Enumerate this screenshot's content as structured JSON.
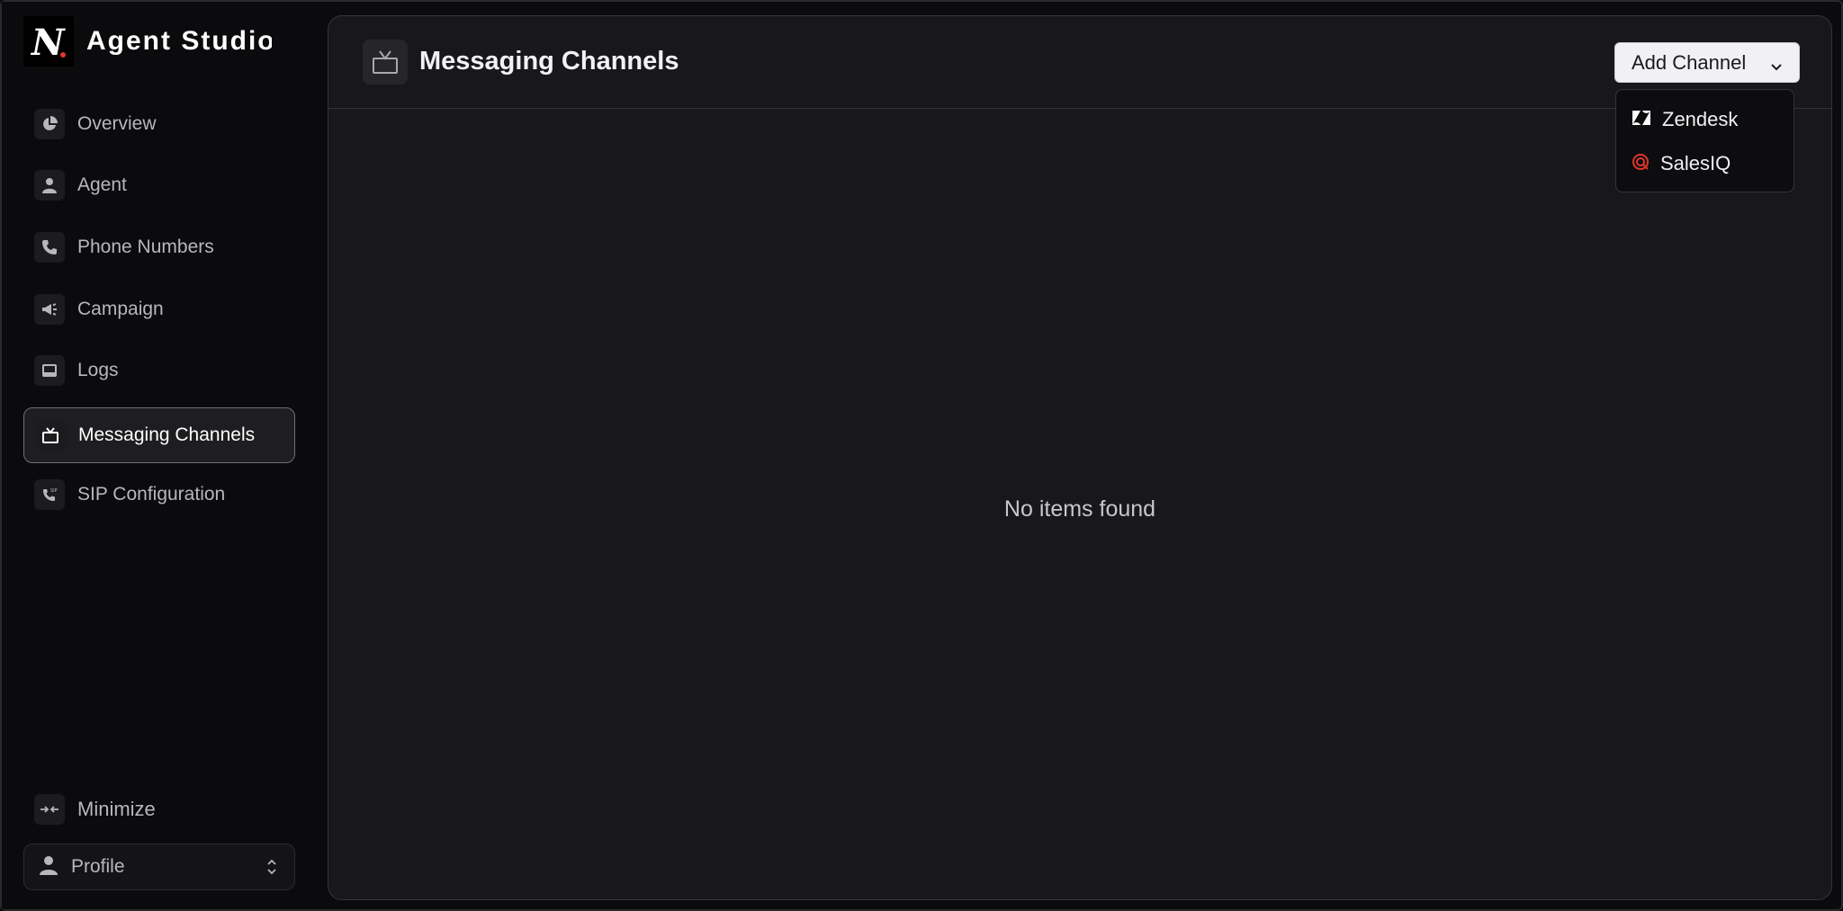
{
  "app": {
    "title": "Agent Studio",
    "logo_text": "N"
  },
  "sidebar": {
    "items": [
      {
        "label": "Overview",
        "icon": "pie-chart-icon",
        "active": false
      },
      {
        "label": "Agent",
        "icon": "person-icon",
        "active": false
      },
      {
        "label": "Phone Numbers",
        "icon": "phone-icon",
        "active": false
      },
      {
        "label": "Campaign",
        "icon": "megaphone-icon",
        "active": false
      },
      {
        "label": "Logs",
        "icon": "terminal-icon",
        "active": false
      },
      {
        "label": "Messaging Channels",
        "icon": "tv-icon",
        "active": true
      },
      {
        "label": "SIP Configuration",
        "icon": "sip-phone-icon",
        "active": false
      }
    ],
    "minimize_label": "Minimize",
    "profile_label": "Profile"
  },
  "main": {
    "title": "Messaging Channels",
    "add_button_label": "Add Channel",
    "empty_message": "No items found"
  },
  "dropdown": {
    "items": [
      {
        "label": "Zendesk",
        "icon": "zendesk-icon"
      },
      {
        "label": "SalesIQ",
        "icon": "salesiq-icon"
      }
    ]
  },
  "colors": {
    "background": "#0b0b0d",
    "panel": "#18181a",
    "active_border": "#6f6f74",
    "salesiq_red": "#e0352b",
    "button_bg": "#f1f1f3"
  }
}
